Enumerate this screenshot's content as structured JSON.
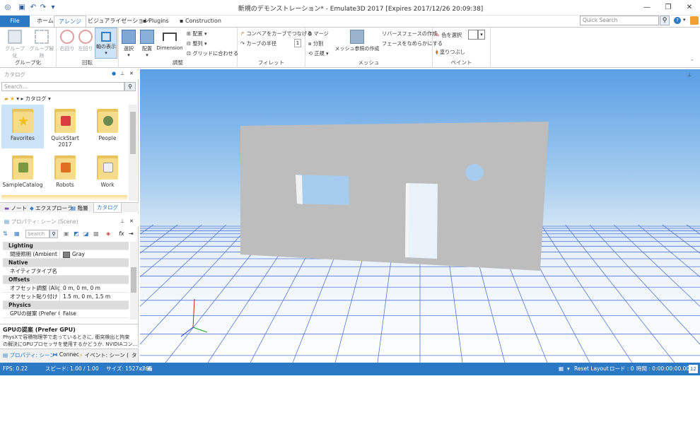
{
  "title": "新規のデモンストレーション* - Emulate3D 2017 [Expires 2017/12/26 20:09:38]",
  "tabs": {
    "file": "File",
    "home": "ホーム",
    "arrange": "アレンジ",
    "visualize": "ビジュアライゼーション",
    "plugins": "Plugins",
    "construction": "Construction"
  },
  "quick_search": {
    "placeholder": "Quick Search"
  },
  "ribbon": {
    "group_label": "グループ化",
    "ungroup_label": "グループ解除",
    "group_group": "グループ化",
    "rot_right": "右回り",
    "rot_left": "左回り",
    "axis": "軸の表示",
    "rot_group": "回転",
    "select": "選択",
    "place": "配置",
    "dimension": "Dimension",
    "arrange": "配置",
    "align": "整列",
    "snap_grid": "グリッドに合わせる",
    "adjust_group": "調整",
    "conveyor_curve": "コンベアをカーブでつなげる",
    "curve_radius": "カーブの半径",
    "curve_radius_val": "1",
    "fillet_group": "フィレット",
    "merge": "マージ",
    "split": "分割",
    "normalize": "正規",
    "mesh_ref": "メッシュ参照の作成",
    "reverse_face": "リバースフェースの作成",
    "smooth_face": "フェースをなめらかにする",
    "mesh_group": "メッシュ",
    "pick_color": "色を選択",
    "fill": "塗りつぶし",
    "paint_group": "ペイント"
  },
  "catalog": {
    "header": "カタログ",
    "search_placeholder": "Search...",
    "breadcrumb": "カタログ",
    "items": [
      "Favorites",
      "QuickStart 2017",
      "People",
      "SampleCatalog",
      "Robots",
      "Work"
    ],
    "tabs": [
      "ノート",
      "エクスプローラ",
      "階層",
      "カタログ"
    ]
  },
  "properties": {
    "header": "プロパティ: シーン (Scene)",
    "search_placeholder": "Search",
    "rows": [
      {
        "type": "cat",
        "k": "Lighting"
      },
      {
        "type": "kv",
        "k": "間接照明 (Ambient Lig",
        "v": "Gray"
      },
      {
        "type": "cat",
        "k": "Native"
      },
      {
        "type": "kv",
        "k": "ネイティブタイプ名 (Nati",
        "v": ""
      },
      {
        "type": "cat",
        "k": "Offsets"
      },
      {
        "type": "kv",
        "k": "オフセット調整 (Align O",
        "v": "0 m, 0 m, 0 m"
      },
      {
        "type": "kv",
        "k": "オフセット貼り付け (Paste",
        "v": "1.5 m, 0 m, 1.5 m"
      },
      {
        "type": "cat",
        "k": "Physics"
      },
      {
        "type": "kv",
        "k": "GPUの提案 (Prefer GPU",
        "v": "False"
      }
    ],
    "desc_title": "GPUの提案 (Prefer GPU)",
    "desc_l1": "PhysXで容積物理学で走っているときに, 衝突検出と拘束",
    "desc_l2": "の解決にGPUプロセッサを使用するかどうか. NVIDIAコン...",
    "tabs": [
      "プロパティ: シーン",
      "Connec",
      "イベント: シーン (",
      "タ"
    ]
  },
  "status": {
    "fps": "FPS: 0.22",
    "speed": "スピード: 1.00 / 1.00",
    "size": "サイズ: 1527x765",
    "display": "画面表示設定",
    "reset": "Reset Layout",
    "load": "ロード : 0",
    "time": "時間 : 0:00:00:00.00",
    "num": "12"
  }
}
